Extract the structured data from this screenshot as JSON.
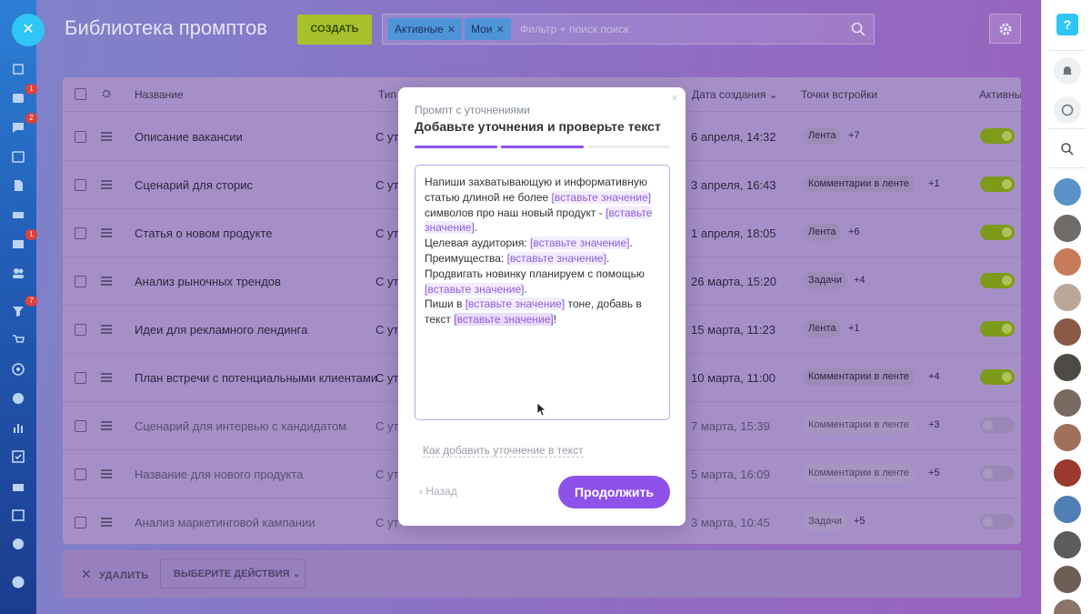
{
  "app": {
    "title": "Библиотека промптов",
    "create_label": "СОЗДАТЬ",
    "filter_chips": [
      "Активные",
      "Мои"
    ],
    "filter_placeholder": "Фильтр + поиск поиск"
  },
  "left_rail": {
    "badges": [
      "1",
      "2",
      "1",
      "7"
    ]
  },
  "table": {
    "headers": {
      "name": "Название",
      "type": "Тип",
      "date": "Дата создания",
      "embed": "Точки встройки",
      "active": "Активны"
    },
    "rows": [
      {
        "name": "Описание вакансии",
        "type": "С утс",
        "date": "6 апреля, 14:32",
        "tag": "Лента",
        "extra": "+7",
        "active": true
      },
      {
        "name": "Сценарий для сторис",
        "type": "С утс",
        "date": "3 апреля, 16:43",
        "tag": "Комментарии в ленте",
        "extra": "+1",
        "active": true
      },
      {
        "name": "Статья о новом продукте",
        "type": "С утс",
        "date": "1 апреля, 18:05",
        "tag": "Лента",
        "extra": "+6",
        "active": true
      },
      {
        "name": "Анализ рыночных трендов",
        "type": "С утс",
        "date": "26 марта, 15:20",
        "tag": "Задачи",
        "extra": "+4",
        "active": true
      },
      {
        "name": "Идеи для рекламного лендинга",
        "type": "С утс",
        "date": "15 марта, 11:23",
        "tag": "Лента",
        "extra": "+1",
        "active": true
      },
      {
        "name": "План встречи с потенциальными клиентами",
        "type": "С ут",
        "date": "10 марта, 11:00",
        "tag": "Комментарии в ленте",
        "extra": "+4",
        "active": true
      },
      {
        "name": "Сценарий для интервью с кандидатом",
        "type": "С ут",
        "date": "7 марта, 15:39",
        "tag": "Комментарии в ленте",
        "extra": "+3",
        "active": false
      },
      {
        "name": "Название для нового продукта",
        "type": "С ут",
        "date": "5 марта, 16:09",
        "tag": "Комментарии в ленте",
        "extra": "+5",
        "active": false
      },
      {
        "name": "Анализ маркетинговой кампании",
        "type": "С ут",
        "date": "3 марта, 10:45",
        "tag": "Задачи",
        "extra": "+5",
        "active": false
      }
    ]
  },
  "footer": {
    "delete_label": "УДАЛИТЬ",
    "actions_label": "ВЫБЕРИТЕ ДЕЙСТВИЯ"
  },
  "modal": {
    "close": "×",
    "subtitle": "Промпт с уточнениями",
    "title": "Добавьте уточнения и проверьте текст",
    "steps_total": 3,
    "steps_done": 2,
    "editor": {
      "t1": "Напиши захватывающую и информативную статью длиной не более ",
      "p": "[вставьте значение]",
      "t2": " символов про наш новый продукт - ",
      "t3": ".",
      "t4": "Целевая аудитория: ",
      "t5": "Преимущества: ",
      "t6": "Продвигать новинку планируем с помощью ",
      "t7": "Пиши в ",
      "t8": " тоне, добавь в текст ",
      "t9": "!"
    },
    "help_link": "Как добавить уточнение в текст",
    "back_label": "Назад",
    "continue_label": "Продолжить"
  },
  "colors": {
    "accent": "#8e52ea",
    "placeholder": "#8e5ed8",
    "toggle_on": "#7e9a1a"
  }
}
